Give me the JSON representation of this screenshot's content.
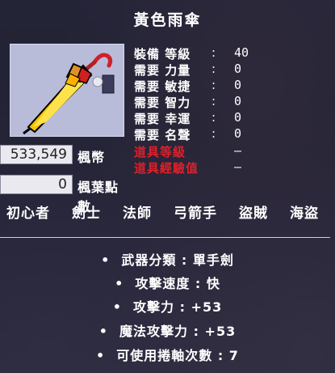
{
  "item": {
    "name": "黃色雨傘",
    "icon": "yellow-umbrella-icon"
  },
  "requirements": [
    {
      "label": "裝備 等級",
      "value": "40",
      "locked": false
    },
    {
      "label": "需要 力量",
      "value": "0",
      "locked": false
    },
    {
      "label": "需要 敏捷",
      "value": "0",
      "locked": false
    },
    {
      "label": "需要 智力",
      "value": "0",
      "locked": false
    },
    {
      "label": "需要 幸運",
      "value": "0",
      "locked": false
    },
    {
      "label": "需要 名聲",
      "value": "0",
      "locked": false
    },
    {
      "label": "道具等級",
      "value": "—",
      "locked": true
    },
    {
      "label": "道具經驗值",
      "value": "—",
      "locked": true
    }
  ],
  "currency": {
    "mesos_value": "533,549",
    "mesos_label": "楓幣",
    "maple_points_value": "0",
    "maple_points_label": "楓葉點數"
  },
  "jobs": [
    "初心者",
    "劍士",
    "法師",
    "弓箭手",
    "盜賊",
    "海盜"
  ],
  "details": [
    {
      "bullet": "•",
      "text": "武器分類 : 單手劍"
    },
    {
      "bullet": "•",
      "text": "攻擊速度 : 快"
    },
    {
      "bullet": "•",
      "text": "攻擊力 : +53"
    },
    {
      "bullet": "•",
      "text": "魔法攻擊力 : +53"
    },
    {
      "bullet": "•",
      "text": "可使用捲軸次數 : 7"
    }
  ],
  "colors": {
    "text": "#ffffff",
    "locked": "#e0202a",
    "icon_bg": "#b9bcd8"
  }
}
